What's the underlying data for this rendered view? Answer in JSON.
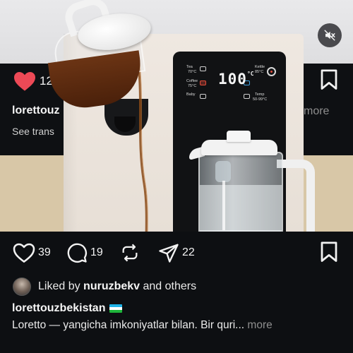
{
  "previous_post": {
    "like_count": "12",
    "username": "lorettouz",
    "more_label": "more",
    "see_translation": "See trans"
  },
  "video": {
    "panel_labels": [
      "Tea",
      "70°C",
      "Coffee",
      "75°C",
      "Baby",
      "Kettle",
      "85°C",
      "Temp",
      "50-99°C"
    ],
    "temperature_display": "100",
    "temperature_unit": "°C",
    "mute_icon": "speaker-muted-icon"
  },
  "post": {
    "actions": {
      "like_count": "39",
      "comment_count": "19",
      "share_count": "22"
    },
    "liked_by_prefix": "Liked by ",
    "liked_by_user": "nuruzbekv",
    "liked_by_suffix": " and others",
    "author": "lorettouzbekistan",
    "caption": "Loretto — yangicha imkoniyatlar bilan. Bir quri...",
    "caption_more": " more"
  },
  "colors": {
    "like_active": "#ed4956",
    "muted_text": "#8e8e8e",
    "background": "#0d0f12"
  }
}
